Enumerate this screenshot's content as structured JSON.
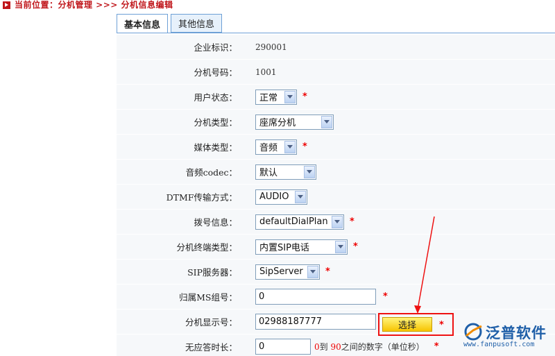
{
  "breadcrumb": {
    "text": "当前位置：分机管理 >>> 分机信息编辑"
  },
  "tabs": [
    {
      "label": "基本信息",
      "active": true
    },
    {
      "label": "其他信息",
      "active": false
    }
  ],
  "fields": {
    "enterprise_id": {
      "label": "企业标识：",
      "value": "290001"
    },
    "extension_number": {
      "label": "分机号码：",
      "value": "1001"
    },
    "user_status": {
      "label": "用户状态：",
      "value": "正常",
      "required": "*"
    },
    "extension_type": {
      "label": "分机类型：",
      "value": "座席分机"
    },
    "media_type": {
      "label": "媒体类型：",
      "value": "音频",
      "required": "*"
    },
    "audio_codec": {
      "label": "音频codec：",
      "value": "默认"
    },
    "dtmf_mode": {
      "label": "DTMF传输方式：",
      "value": "AUDIO"
    },
    "dial_info": {
      "label": "拨号信息：",
      "value": "defaultDialPlan",
      "required": "*"
    },
    "terminal_type": {
      "label": "分机终端类型：",
      "value": "内置SIP电话",
      "required": "*"
    },
    "sip_server": {
      "label": "SIP服务器：",
      "value": "SipServer",
      "required": "*"
    },
    "ms_group": {
      "label": "归属MS组号：",
      "value": "0",
      "required": "*"
    },
    "display_number": {
      "label": "分机显示号：",
      "value": "02988187777",
      "button": "选择",
      "required": "*"
    },
    "no_answer_timeout": {
      "label": "无应答时长：",
      "value": "0",
      "hint_min": "0",
      "hint_to": "到",
      "hint_max": "90",
      "hint_suffix": "之间的数字（单位秒）",
      "required": "*"
    }
  },
  "watermark": {
    "name": "泛普软件",
    "url": "www.fanpusoft.com"
  },
  "colors": {
    "accent_red": "#c0161b",
    "tab_border": "#6da0d6",
    "logo_blue": "#1f5fa8"
  }
}
